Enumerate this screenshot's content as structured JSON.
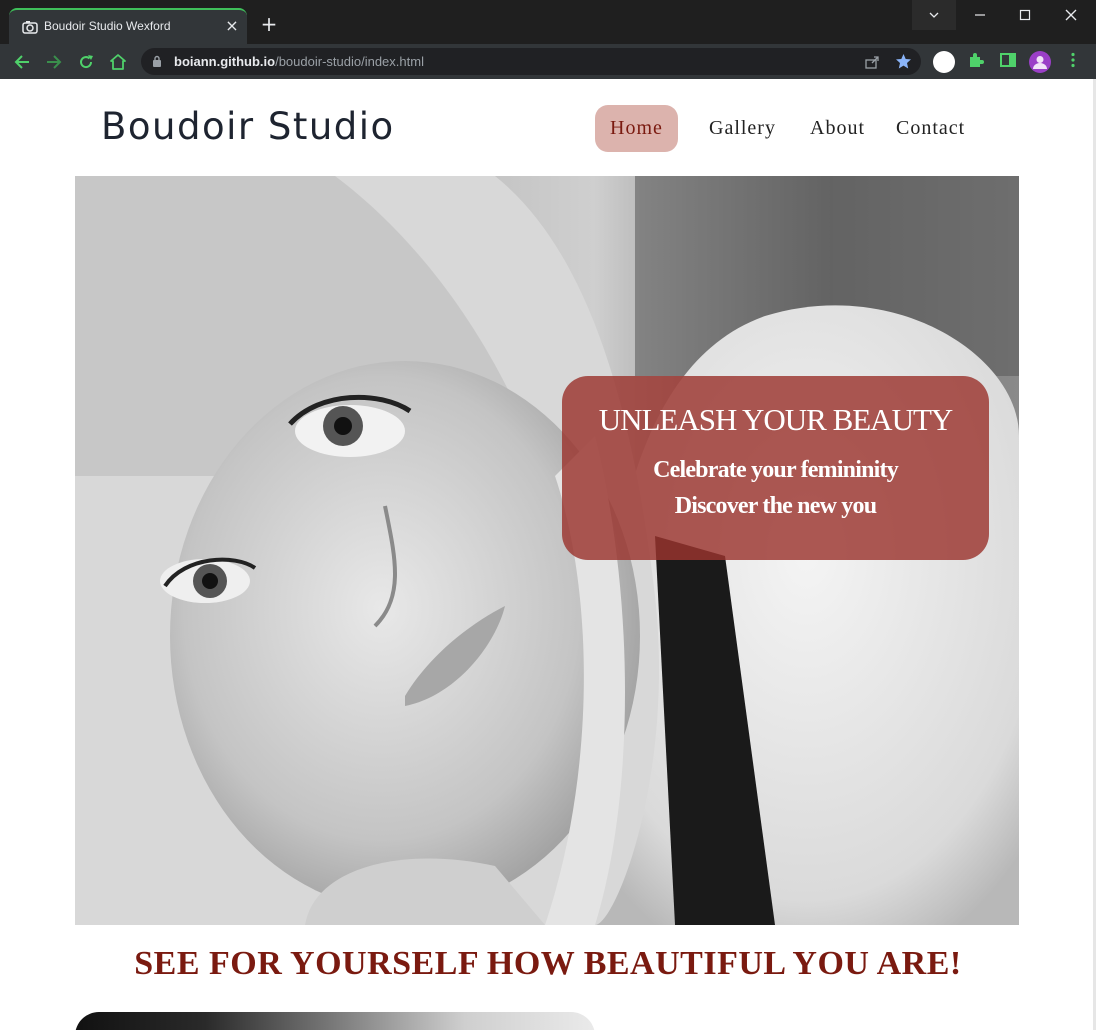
{
  "browser": {
    "tab_title": "Boudoir Studio Wexford",
    "url_host": "boiann.github.io",
    "url_path": "/boudoir-studio/index.html"
  },
  "site": {
    "brand": "Boudoir Studio",
    "nav": [
      {
        "label": "Home",
        "active": true
      },
      {
        "label": "Gallery",
        "active": false
      },
      {
        "label": "About",
        "active": false
      },
      {
        "label": "Contact",
        "active": false
      }
    ]
  },
  "hero": {
    "heading": "UNLEASH YOUR BEAUTY",
    "line1": "Celebrate your femininity",
    "line2": "Discover the new you"
  },
  "tagline": "SEE FOR YOURSELF HOW BEAUTIFUL YOU ARE!",
  "colors": {
    "accent": "#7a1a10",
    "nav_active_bg": "#dcb3ad",
    "overlay_bg": "#9b342e"
  },
  "icons": [
    "back-icon",
    "forward-icon",
    "reload-icon",
    "home-icon",
    "lock-icon",
    "share-icon",
    "star-icon",
    "extensions-icon",
    "side-panel-icon",
    "profile-icon",
    "menu-icon"
  ]
}
